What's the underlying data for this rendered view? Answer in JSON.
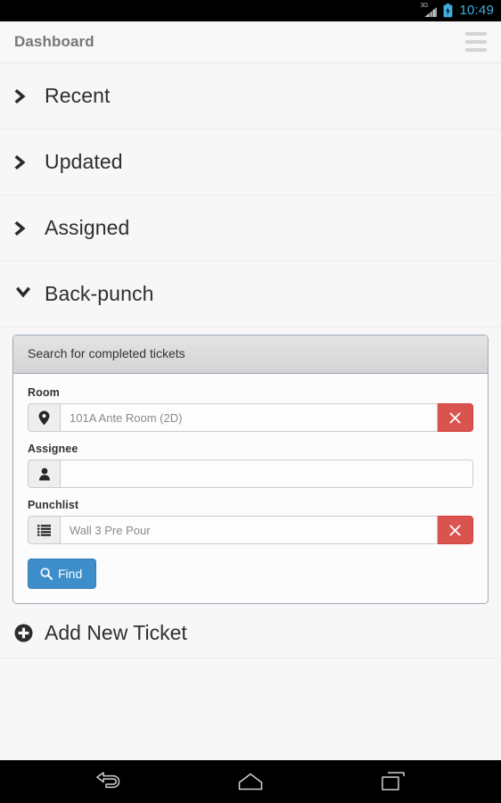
{
  "status_bar": {
    "network_label": "3G",
    "network_icon": "signal-bars-icon",
    "battery_icon": "battery-charging-icon",
    "time": "10:49",
    "time_color": "#3fb0e0"
  },
  "header": {
    "title": "Dashboard",
    "menu_icon": "hamburger-menu-icon"
  },
  "sections": [
    {
      "label": "Recent",
      "icon": "chevron-right-icon",
      "expanded": false
    },
    {
      "label": "Updated",
      "icon": "chevron-right-icon",
      "expanded": false
    },
    {
      "label": "Assigned",
      "icon": "chevron-right-icon",
      "expanded": false
    },
    {
      "label": "Back-punch",
      "icon": "chevron-down-icon",
      "expanded": true
    }
  ],
  "search_panel": {
    "heading": "Search for completed tickets",
    "fields": [
      {
        "label": "Room",
        "icon": "map-marker-icon",
        "value": "101A Ante Room (2D)",
        "placeholder": "",
        "has_clear": true,
        "clear_icon": "close-x-icon"
      },
      {
        "label": "Assignee",
        "icon": "user-icon",
        "value": "",
        "placeholder": "",
        "has_clear": false,
        "clear_icon": ""
      },
      {
        "label": "Punchlist",
        "icon": "list-icon",
        "value": "Wall 3 Pre Pour",
        "placeholder": "",
        "has_clear": true,
        "clear_icon": "close-x-icon"
      }
    ],
    "find_button": {
      "label": "Find",
      "icon": "search-icon",
      "color": "#3e8ecc"
    },
    "clear_button_color": "#d9534f"
  },
  "add_ticket": {
    "label": "Add New Ticket",
    "icon": "plus-circle-icon"
  },
  "nav_bar": {
    "back_icon": "back-arrow-icon",
    "home_icon": "home-icon",
    "recents_icon": "recent-apps-icon"
  }
}
